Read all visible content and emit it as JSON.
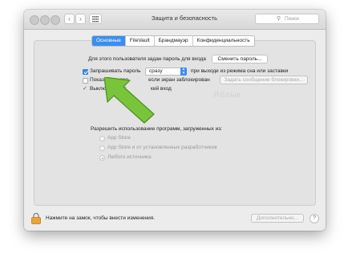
{
  "window": {
    "title": "Защита и безопасность"
  },
  "toolbar": {
    "back": "‹",
    "forward": "›",
    "search_placeholder": "Поиск"
  },
  "tabs": [
    {
      "label": "Основные",
      "active": true
    },
    {
      "label": "FileVault",
      "active": false
    },
    {
      "label": "Брандмауэр",
      "active": false
    },
    {
      "label": "Конфиденциальность",
      "active": false
    }
  ],
  "general": {
    "password_set_text": "Для этого пользователя задан пароль для входа",
    "change_password_button": "Сменить пароль...",
    "require_password": {
      "label": "Запрашивать пароль",
      "checked": true
    },
    "require_select_value": "сразу",
    "after_sleep_text": "при выходе из режима сна или заставки",
    "show_message": {
      "label_left": "Показывать соо",
      "label_right": "если экран заблокирован",
      "checked": false
    },
    "set_lock_message_button": "Задать сообщение блокировки...",
    "disable_autologin": {
      "label_left": "Выключить авт",
      "label_right": "кий вход",
      "checked": true
    }
  },
  "apps": {
    "heading": "Разрешить использование программ, загруженных из:",
    "options": [
      {
        "label": "App Store",
        "selected": false
      },
      {
        "label": "App Store и от установленных разработчиков",
        "selected": false
      },
      {
        "label": "Любого источника",
        "selected": true
      }
    ]
  },
  "watermark": "Яблык",
  "footer": {
    "lock_text": "Нажмите на замок, чтобы внести изменения.",
    "advanced_button": "Дополнительно...",
    "help": "?"
  },
  "colors": {
    "accent": "#3a8ef0",
    "arrow": "#78c43a"
  }
}
